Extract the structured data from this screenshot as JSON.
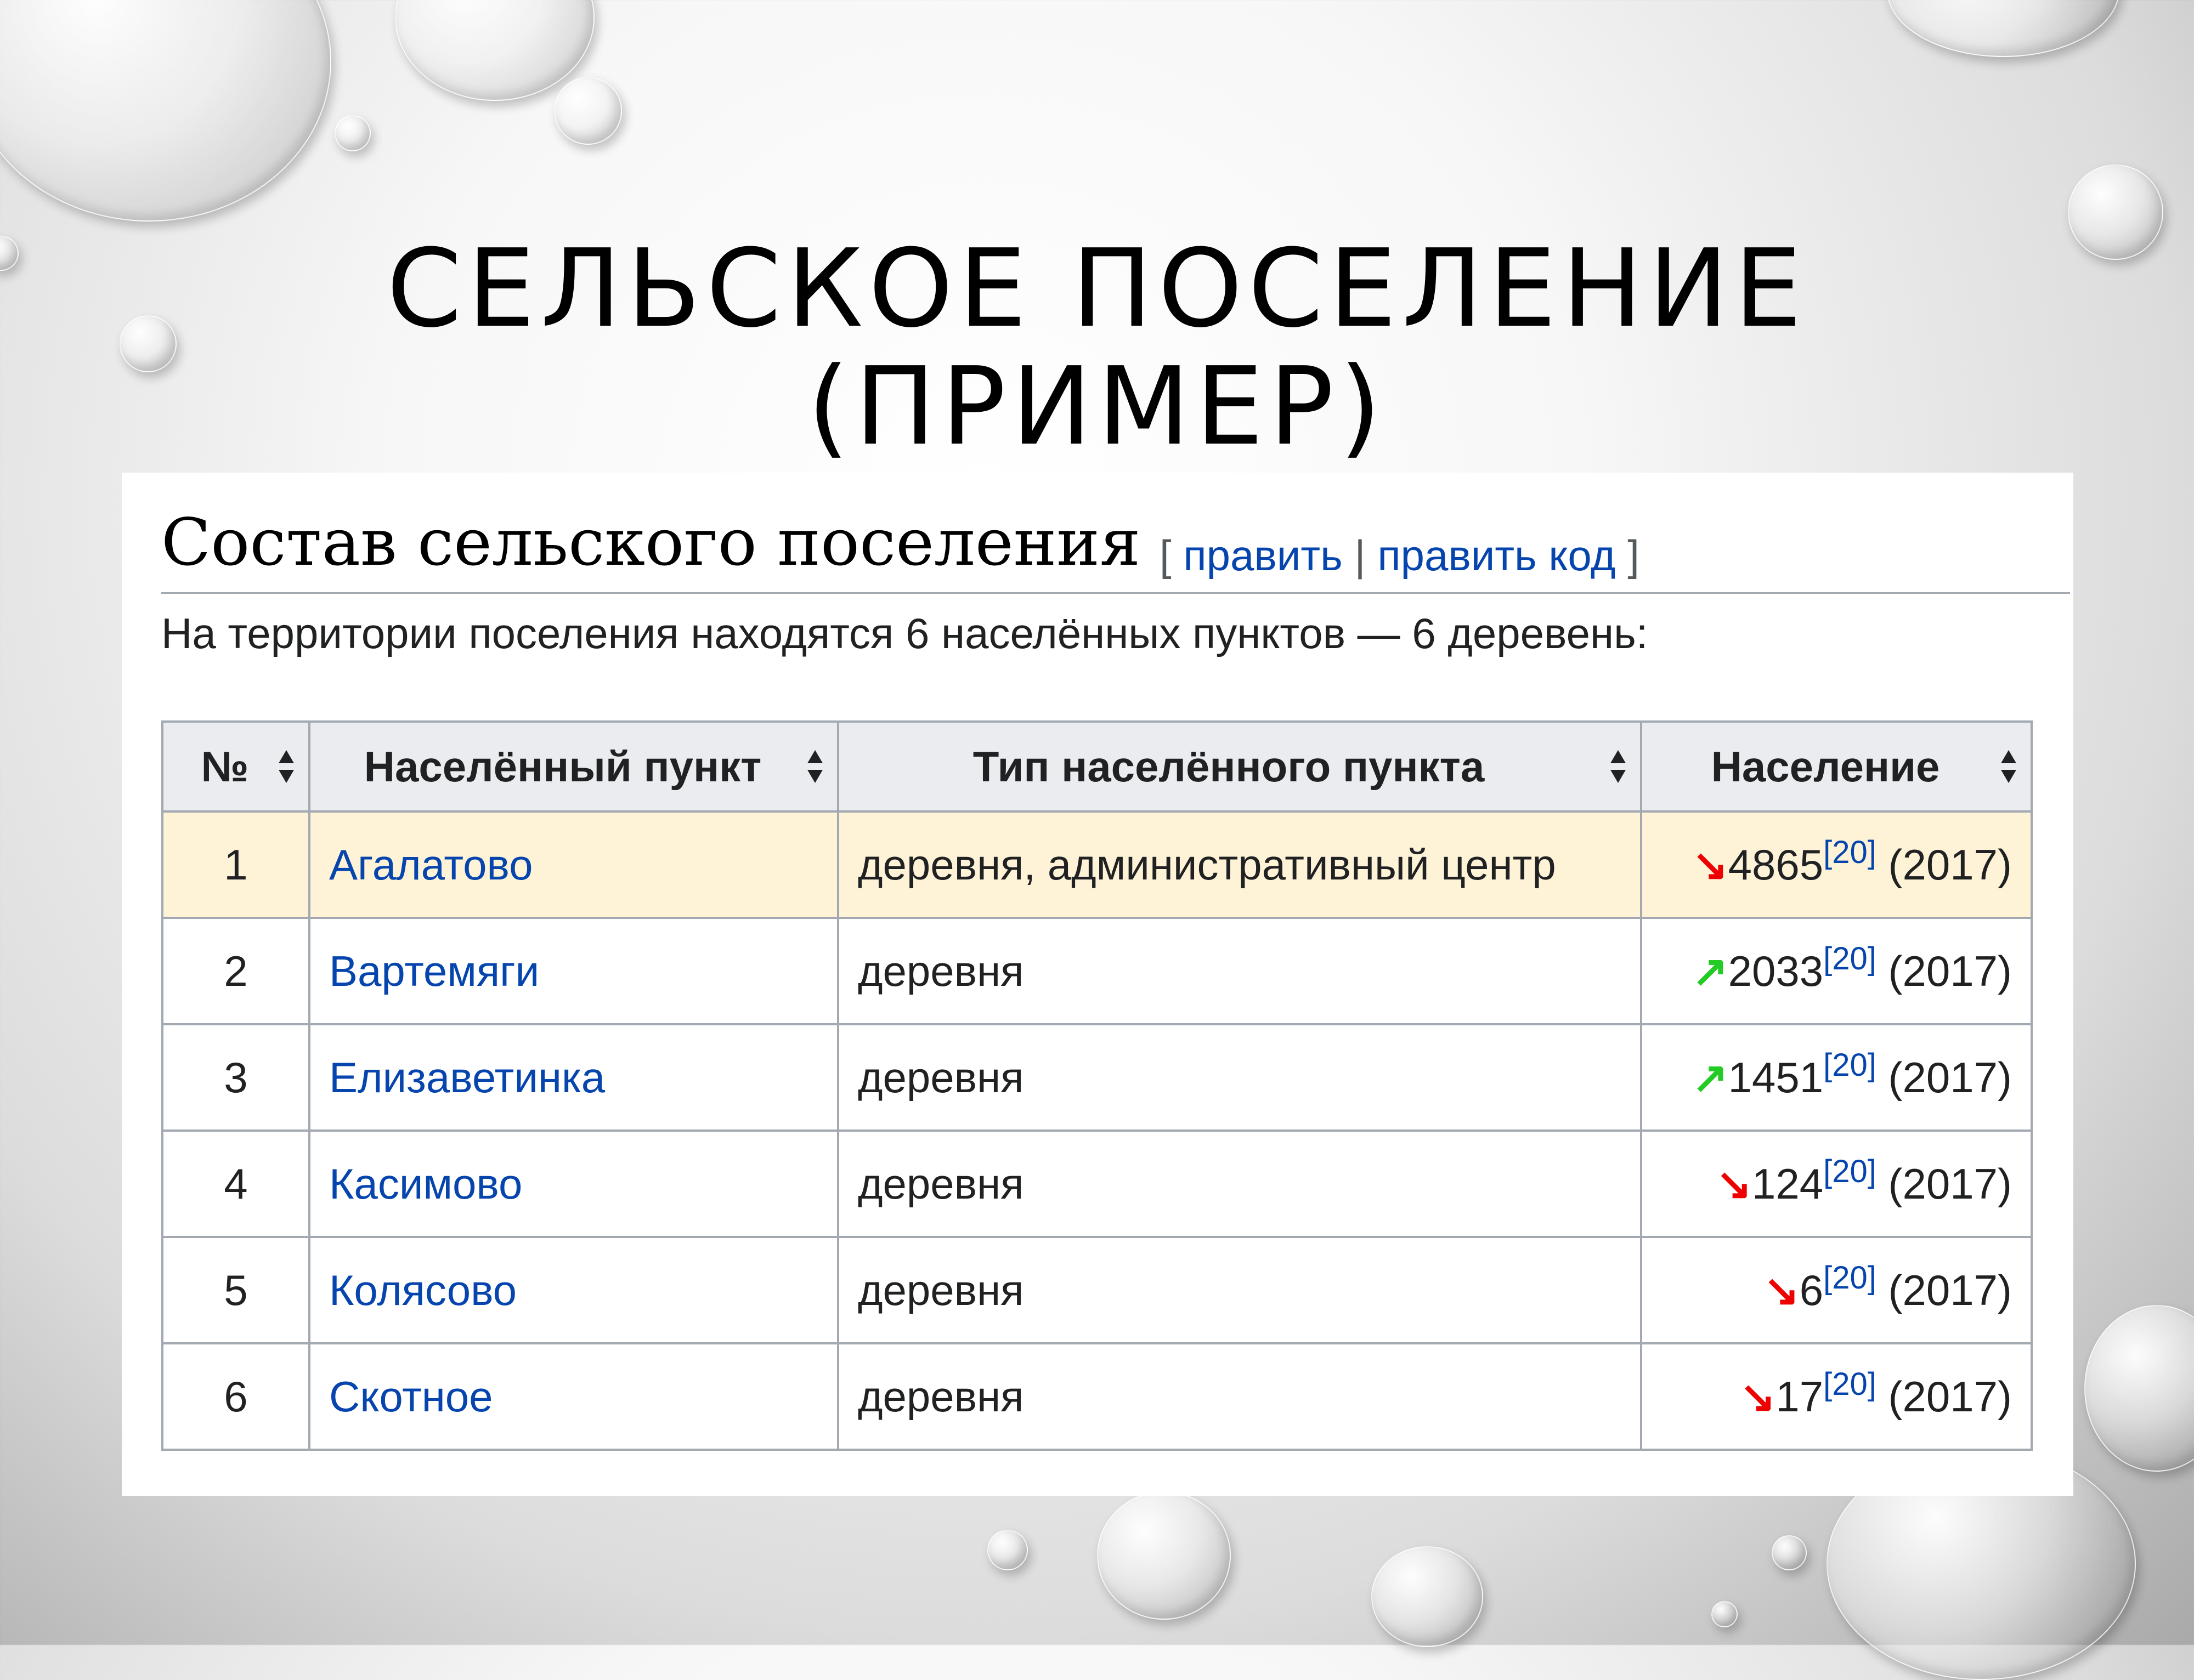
{
  "slide": {
    "title_line1": "СЕЛЬСКОЕ ПОСЕЛЕНИЕ",
    "title_line2": "(ПРИМЕР)"
  },
  "section": {
    "title": "Состав сельского поселения",
    "edit_open": "[ ",
    "edit_label": "править",
    "edit_sep": " | ",
    "edit_code_label": "править код",
    "edit_close": " ]",
    "intro": "На территории поселения находятся 6 населённых пунктов — 6 деревень:"
  },
  "table": {
    "headers": [
      "№",
      "Населённый пункт",
      "Тип населённого пункта",
      "Население"
    ],
    "rows": [
      {
        "num": "1",
        "name": "Агалатово",
        "type": "деревня, административный центр",
        "trend": "↘",
        "trend_dir": "down",
        "population": "4865",
        "ref": "[20]",
        "year": " (2017)"
      },
      {
        "num": "2",
        "name": "Вартемяги",
        "type": "деревня",
        "trend": "↗",
        "trend_dir": "up",
        "population": "2033",
        "ref": "[20]",
        "year": " (2017)"
      },
      {
        "num": "3",
        "name": "Елизаветинка",
        "type": "деревня",
        "trend": "↗",
        "trend_dir": "up",
        "population": "1451",
        "ref": "[20]",
        "year": " (2017)"
      },
      {
        "num": "4",
        "name": "Касимово",
        "type": "деревня",
        "trend": "↘",
        "trend_dir": "down",
        "population": "124",
        "ref": "[20]",
        "year": " (2017)"
      },
      {
        "num": "5",
        "name": "Колясово",
        "type": "деревня",
        "trend": "↘",
        "trend_dir": "down",
        "population": "6",
        "ref": "[20]",
        "year": " (2017)"
      },
      {
        "num": "6",
        "name": "Скотное",
        "type": "деревня",
        "trend": "↘",
        "trend_dir": "down",
        "population": "17",
        "ref": "[20]",
        "year": " (2017)"
      }
    ]
  },
  "colors": {
    "link": "#0645ad",
    "header_bg": "#eaecf0",
    "highlight_row": "#fef2d7",
    "trend_down": "#ee0000",
    "trend_up": "#22cc22"
  }
}
